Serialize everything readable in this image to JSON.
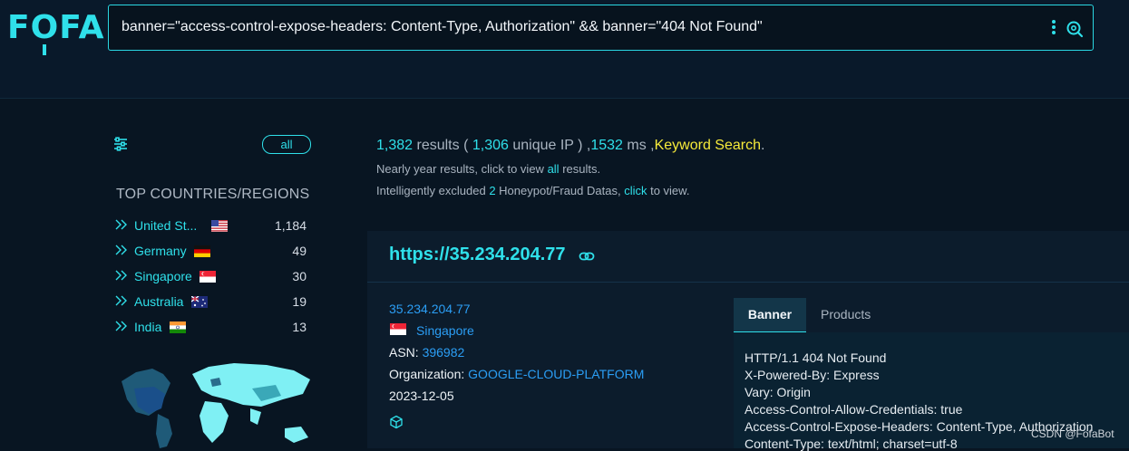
{
  "logo": "FOFA",
  "search": {
    "query": "banner=\"access-control-expose-headers: Content-Type, Authorization\" && banner=\"404 Not Found\""
  },
  "sidebar": {
    "all_label": "all",
    "top_title": "TOP COUNTRIES/REGIONS",
    "countries": [
      {
        "name": "United St...",
        "count": "1,184",
        "flag": "us-flag"
      },
      {
        "name": "Germany",
        "count": "49",
        "flag": "de-flag"
      },
      {
        "name": "Singapore",
        "count": "30",
        "flag": "sg-flag"
      },
      {
        "name": "Australia",
        "count": "19",
        "flag": "au-flag"
      },
      {
        "name": "India",
        "count": "13",
        "flag": "in-flag"
      }
    ]
  },
  "summary": {
    "results": "1,382",
    "results_label": " results ( ",
    "unique_ip": "1,306",
    "unique_label": " unique IP ) ,",
    "ms": "1532",
    "ms_label": " ms ,",
    "keyword": "Keyword Search",
    "period": ".",
    "line2_pre": "Nearly year results, click to view ",
    "line2_link": "all",
    "line2_post": " results.",
    "line3_pre": "Intelligently excluded ",
    "line3_num": "2",
    "line3_mid": " Honeypot/Fraud Datas, ",
    "line3_link": "click",
    "line3_post": " to view."
  },
  "result": {
    "url": "https://35.234.204.77",
    "ip": "35.234.204.77",
    "country": "Singapore",
    "asn_label": "ASN: ",
    "asn": "396982",
    "org_label": "Organization: ",
    "org": "GOOGLE-CLOUD-PLATFORM",
    "date": "2023-12-05",
    "tabs": {
      "banner": "Banner",
      "products": "Products"
    },
    "banner_lines": [
      "HTTP/1.1 404 Not Found",
      "X-Powered-By: Express",
      "Vary: Origin",
      "Access-Control-Allow-Credentials: true",
      "Access-Control-Expose-Headers: Content-Type, Authorization",
      "Content-Type: text/html; charset=utf-8"
    ]
  },
  "watermark": "CSDN @FofaBot",
  "colors": {
    "accent": "#2fe0ea",
    "link": "#2b9ef5",
    "keyword": "#f6ea3a",
    "background": "#081522"
  }
}
